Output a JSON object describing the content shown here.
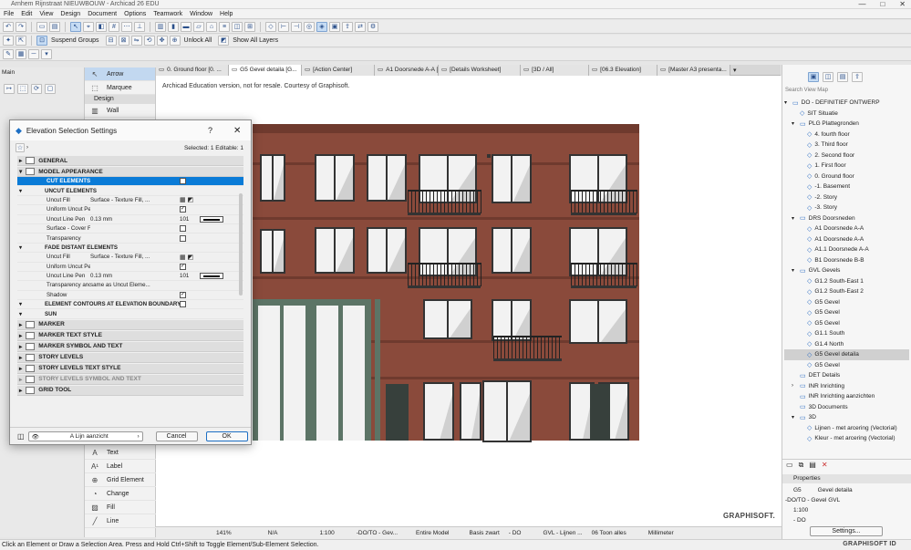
{
  "window": {
    "title": "Arnhem Rijnstraat NIEUWBOUW - Archicad 26 EDU",
    "min": "—",
    "max": "□",
    "close": "✕"
  },
  "menu": [
    "File",
    "Edit",
    "View",
    "Design",
    "Document",
    "Options",
    "Teamwork",
    "Window",
    "Help"
  ],
  "toolbar": {
    "suspend_groups": "Suspend Groups",
    "unlock_all": "Unlock All",
    "show_all_layers": "Show All Layers"
  },
  "toolbox": {
    "main_label": "Main",
    "design_label": "Design",
    "items_top": [
      {
        "label": "Arrow",
        "icon": "arrow-icon"
      },
      {
        "label": "Marquee",
        "icon": "marquee-icon"
      }
    ],
    "items_design": [
      {
        "label": "Wall",
        "icon": "wall-icon"
      }
    ],
    "items_bottom": [
      {
        "label": "Text",
        "icon": "text-icon"
      },
      {
        "label": "Label",
        "icon": "label-icon"
      },
      {
        "label": "Grid Element",
        "icon": "grid-element-icon"
      },
      {
        "label": "Change",
        "icon": "change-icon"
      },
      {
        "label": "Fill",
        "icon": "fill-icon"
      },
      {
        "label": "Line",
        "icon": "line-icon"
      }
    ]
  },
  "tabs": [
    "0. Ground floor [0. ...",
    "G5 Gevel detaila [G...",
    "[Action Center]",
    "A1 Doorsnede A-A [...",
    "[Details Worksheet]",
    "[3D / All]",
    "[06.3 Elevation]",
    "[Master A3 presenta..."
  ],
  "canvas": {
    "notice": "Archicad Education version, not for resale. Courtesy of Graphisoft.",
    "watermark": "GRAPHISOFT."
  },
  "bottom_bar": {
    "zoom": "141%",
    "angle": "N/A",
    "scale": "1:100",
    "layer": "-DO/TO - Gev...",
    "model": "Entire Model",
    "pen": "Basis zwart",
    "struct": "- DO",
    "graphic": "GVL - Lijnen ...",
    "renovation": "06 Toon alles",
    "unit": "Millimeter"
  },
  "status_text": "Click an Element or Draw a Selection Area. Press and Hold Ctrl+Shift to Toggle Element/Sub-Element Selection.",
  "graphisoft_id": "GRAPHISOFT ID",
  "navigator": {
    "search_placeholder": "Search View Map",
    "items": [
      {
        "label": "DO - DEFINITIEF ONTWERP",
        "level": 0,
        "arrow": "▾",
        "kind": "folder"
      },
      {
        "label": "SIT Situatie",
        "level": 1,
        "arrow": "",
        "kind": "view"
      },
      {
        "label": "PLG Plattegronden",
        "level": 1,
        "arrow": "▾",
        "kind": "folder"
      },
      {
        "label": "4. fourth floor",
        "level": 2,
        "arrow": "",
        "kind": "view"
      },
      {
        "label": "3. Third floor",
        "level": 2,
        "arrow": "",
        "kind": "view"
      },
      {
        "label": "2. Second floor",
        "level": 2,
        "arrow": "",
        "kind": "view"
      },
      {
        "label": "1. First floor",
        "level": 2,
        "arrow": "",
        "kind": "view"
      },
      {
        "label": "0. Ground floor",
        "level": 2,
        "arrow": "",
        "kind": "view"
      },
      {
        "label": "-1. Basement",
        "level": 2,
        "arrow": "",
        "kind": "view"
      },
      {
        "label": "-2. Story",
        "level": 2,
        "arrow": "",
        "kind": "view"
      },
      {
        "label": "-3. Story",
        "level": 2,
        "arrow": "",
        "kind": "view"
      },
      {
        "label": "DRS Doorsneden",
        "level": 1,
        "arrow": "▾",
        "kind": "folder"
      },
      {
        "label": "A1 Doorsnede A-A",
        "level": 2,
        "arrow": "",
        "kind": "view"
      },
      {
        "label": "A1 Doorsnede A-A",
        "level": 2,
        "arrow": "",
        "kind": "view"
      },
      {
        "label": "A1.1 Doorsnede A-A",
        "level": 2,
        "arrow": "",
        "kind": "view"
      },
      {
        "label": "B1 Doorsnede B-B",
        "level": 2,
        "arrow": "",
        "kind": "view"
      },
      {
        "label": "GVL Gevels",
        "level": 1,
        "arrow": "▾",
        "kind": "folder"
      },
      {
        "label": "G1.2 South-East 1",
        "level": 2,
        "arrow": "",
        "kind": "view"
      },
      {
        "label": "G1.2 South-East 2",
        "level": 2,
        "arrow": "",
        "kind": "view"
      },
      {
        "label": "G5 Gevel",
        "level": 2,
        "arrow": "",
        "kind": "view"
      },
      {
        "label": "G5 Gevel",
        "level": 2,
        "arrow": "",
        "kind": "view"
      },
      {
        "label": "G5 Gevel",
        "level": 2,
        "arrow": "",
        "kind": "view"
      },
      {
        "label": "G1.1 South",
        "level": 2,
        "arrow": "",
        "kind": "view"
      },
      {
        "label": "G1.4 North",
        "level": 2,
        "arrow": "",
        "kind": "view"
      },
      {
        "label": "G5 Gevel detaila",
        "level": 2,
        "arrow": "",
        "kind": "view",
        "selected": true
      },
      {
        "label": "G5 Gevel",
        "level": 2,
        "arrow": "",
        "kind": "view"
      },
      {
        "label": "DET Details",
        "level": 1,
        "arrow": "",
        "kind": "folder"
      },
      {
        "label": "INR Inrichting",
        "level": 1,
        "arrow": "›",
        "kind": "folder"
      },
      {
        "label": "INR Inrichting aanzichten",
        "level": 1,
        "arrow": "",
        "kind": "folder"
      },
      {
        "label": "3D Documents",
        "level": 1,
        "arrow": "",
        "kind": "folder"
      },
      {
        "label": "3D",
        "level": 1,
        "arrow": "▾",
        "kind": "folder"
      },
      {
        "label": "Lijnen - met arcering (Vectorial)",
        "level": 2,
        "arrow": "",
        "kind": "view"
      },
      {
        "label": "Kleur - met arcering (Vectorial)",
        "level": 2,
        "arrow": "",
        "kind": "view"
      }
    ]
  },
  "properties": {
    "title": "Properties",
    "id": "G5",
    "name": "Gevel detaila",
    "layer": "-DO/TO - Gevel GVL",
    "scale": "1:100",
    "struct": "- DO",
    "settings_btn": "Settings..."
  },
  "dialog": {
    "title": "Elevation Selection Settings",
    "help": "?",
    "selected_info": "Selected: 1 Editable: 1",
    "sections_top": [
      {
        "label": "GENERAL",
        "open": false
      },
      {
        "label": "MODEL APPEARANCE",
        "open": true
      }
    ],
    "cut_elements": "CUT ELEMENTS",
    "rows": [
      {
        "type": "sub",
        "label": "UNCUT ELEMENTS"
      },
      {
        "type": "row",
        "label": "Uncut Fill",
        "value": "Surface - Texture Fill, ...",
        "ctrl": "icons"
      },
      {
        "type": "row",
        "label": "Uniform Uncut Pens",
        "value": "",
        "ctrl": "check",
        "checked": true
      },
      {
        "type": "row",
        "label": "Uncut Line Pen",
        "value": "0.13 mm",
        "pen": "101",
        "ctrl": "pen"
      },
      {
        "type": "row",
        "label": "Surface - Cover Fill Foregro...",
        "value": "",
        "ctrl": "check",
        "checked": false
      },
      {
        "type": "row",
        "label": "Transparency",
        "value": "",
        "ctrl": "check",
        "checked": false
      },
      {
        "type": "sub",
        "label": "FADE DISTANT ELEMENTS"
      },
      {
        "type": "row",
        "label": "Uncut Fill",
        "value": "Surface - Texture Fill, ...",
        "ctrl": "icons"
      },
      {
        "type": "row",
        "label": "Uniform Uncut Pens",
        "value": "",
        "ctrl": "check",
        "checked": true
      },
      {
        "type": "row",
        "label": "Uncut Line Pen",
        "value": "0.13 mm",
        "pen": "101",
        "ctrl": "pen"
      },
      {
        "type": "row",
        "label": "Transparency and Shading",
        "value": "same as Uncut Eleme...",
        "ctrl": "none"
      },
      {
        "type": "row",
        "label": "Shadow",
        "value": "",
        "ctrl": "check",
        "checked": true
      },
      {
        "type": "sub",
        "label": "ELEMENT CONTOURS AT ELEVATION BOUNDARY",
        "ctrl": "check",
        "checked": false
      },
      {
        "type": "sub",
        "label": "SUN"
      }
    ],
    "sections_bottom": [
      "MARKER",
      "MARKER TEXT STYLE",
      "MARKER SYMBOL AND TEXT",
      "STORY LEVELS",
      "STORY LEVELS TEXT STYLE",
      "STORY LEVELS SYMBOL AND TEXT",
      "GRID TOOL"
    ],
    "layer_value": "A Lijn aanzicht",
    "cancel": "Cancel",
    "ok": "OK"
  },
  "colors": {
    "brick": "#8a4a3b",
    "brick_dark": "#6f3a2e",
    "frame": "#5c7466",
    "glass": "#f2f2f2",
    "accent": "#0a7bd7"
  }
}
